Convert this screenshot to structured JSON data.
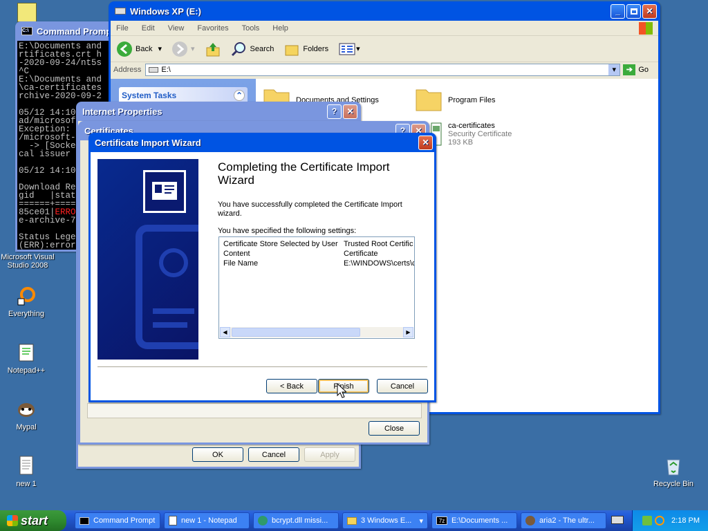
{
  "colors": {
    "desktop": "#3a6ea5",
    "title_active": "#0054e3",
    "title_inactive": "#7a96df",
    "error_red": "#ff2020"
  },
  "desktop_icons": [
    {
      "label": "Microsoft Visual Studio 2008",
      "icon": "visual-studio-icon"
    },
    {
      "label": "Everything",
      "icon": "everything-icon"
    },
    {
      "label": "Notepad++",
      "icon": "notepad-plus-plus-icon"
    },
    {
      "label": "Mypal",
      "icon": "mypal-icon"
    },
    {
      "label": "new 1",
      "icon": "text-file-icon"
    },
    {
      "label": "Recycle Bin",
      "icon": "recycle-bin-icon"
    }
  ],
  "cmd": {
    "title": "Command Prompt",
    "lines": [
      "E:\\Documents and",
      "rtificates.crt h",
      "-2020-09-24/nt5s",
      "^C",
      "E:\\Documents and",
      "\\ca-certificates",
      "rchive-2020-09-2",
      "",
      "05/12 14:10",
      "ad/microsof",
      "Exception: ",
      "/microsoft-",
      "  -> [Socke",
      "cal issuer ",
      "",
      "05/12 14:10",
      "",
      "Download Re",
      "gid   |stat",
      "======+====",
      "85ce01|",
      "e-archive-7",
      "",
      "Status Lege",
      "(ERR):error"
    ],
    "err_fragment": "ERRO"
  },
  "explorer": {
    "title": "Windows XP (E:)",
    "menu": [
      "File",
      "Edit",
      "View",
      "Favorites",
      "Tools",
      "Help"
    ],
    "toolbar": {
      "back": "Back",
      "search": "Search",
      "folders": "Folders"
    },
    "address_label": "Address",
    "address_value": "E:\\",
    "go_label": "Go",
    "tasks_title": "System Tasks",
    "files": [
      {
        "name": "Documents and Settings",
        "type": "folder"
      },
      {
        "name": "Program Files",
        "type": "folder"
      },
      {
        "name": "ca-certificates",
        "sub1": "Security Certificate",
        "sub2": "193 KB",
        "type": "certificate"
      }
    ]
  },
  "internet_props": {
    "title": "Internet Properties",
    "ok": "OK",
    "cancel": "Cancel",
    "apply": "Apply"
  },
  "certificates": {
    "title": "Certificates",
    "close": "Close"
  },
  "wizard": {
    "title": "Certificate Import Wizard",
    "heading": "Completing the Certificate Import Wizard",
    "intro": "You have successfully completed the Certificate Import wizard.",
    "settings_label": "You have specified the following settings:",
    "settings": [
      {
        "key": "Certificate Store Selected by User",
        "value": "Trusted Root Certific"
      },
      {
        "key": "Content",
        "value": "Certificate"
      },
      {
        "key": "File Name",
        "value": "E:\\WINDOWS\\certs\\c"
      }
    ],
    "back": "< Back",
    "finish": "Finish",
    "cancel": "Cancel"
  },
  "taskbar": {
    "start": "start",
    "buttons": [
      {
        "label": "Command Prompt",
        "icon": "cmd-icon"
      },
      {
        "label": "new 1 - Notepad",
        "icon": "notepad-icon"
      },
      {
        "label": "bcrypt.dll missi...",
        "icon": "browser-icon"
      },
      {
        "label": "3 Windows E...",
        "icon": "folder-icon"
      },
      {
        "label": "E:\\Documents ...",
        "icon": "7zip-icon"
      },
      {
        "label": "aria2 - The ultr...",
        "icon": "mypal-icon"
      }
    ],
    "clock": "2:18 PM"
  }
}
